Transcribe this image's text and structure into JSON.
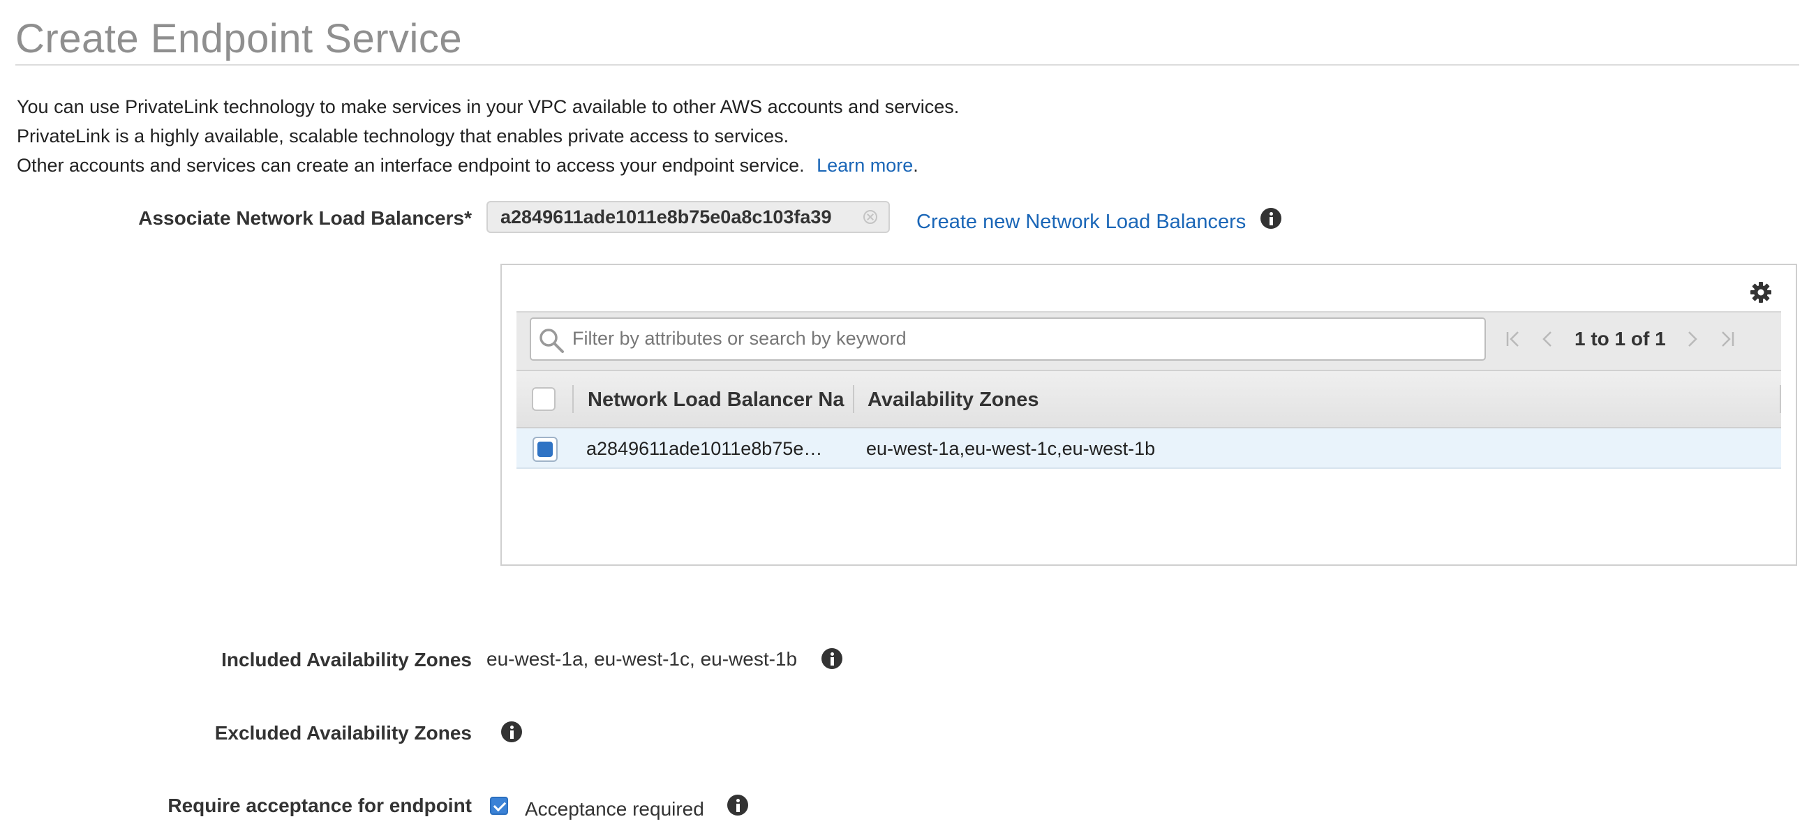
{
  "page": {
    "title": "Create Endpoint Service",
    "intro": {
      "line1": "You can use PrivateLink technology to make services in your VPC available to other AWS accounts and services.",
      "line2": "PrivateLink is a highly available, scalable technology that enables private access to services.",
      "line3": "Other accounts and services can create an interface endpoint to access your endpoint service.",
      "learn_more": "Learn more",
      "period": "."
    }
  },
  "nlb": {
    "label": "Associate Network Load Balancers*",
    "selected_tag": "a2849611ade1011e8b75e0a8c103fa39",
    "create_link": "Create new Network Load Balancers"
  },
  "table": {
    "search_placeholder": "Filter by attributes or search by keyword",
    "pagination": "1 to 1 of 1",
    "columns": [
      "Network Load Balancer Na",
      "Availability Zones"
    ],
    "rows": [
      {
        "name": "a2849611ade1011e8b75e…",
        "zones": "eu-west-1a,eu-west-1c,eu-west-1b",
        "selected": true
      }
    ]
  },
  "zones": {
    "included_label": "Included Availability Zones",
    "included_value": "eu-west-1a, eu-west-1c, eu-west-1b",
    "excluded_label": "Excluded Availability Zones"
  },
  "acceptance": {
    "label": "Require acceptance for endpoint",
    "checkbox_label": "Acceptance required",
    "checked": true
  },
  "icons": {
    "info": "info-icon",
    "gear": "gear-icon",
    "search": "search-icon",
    "clear": "clear-tag-icon"
  }
}
